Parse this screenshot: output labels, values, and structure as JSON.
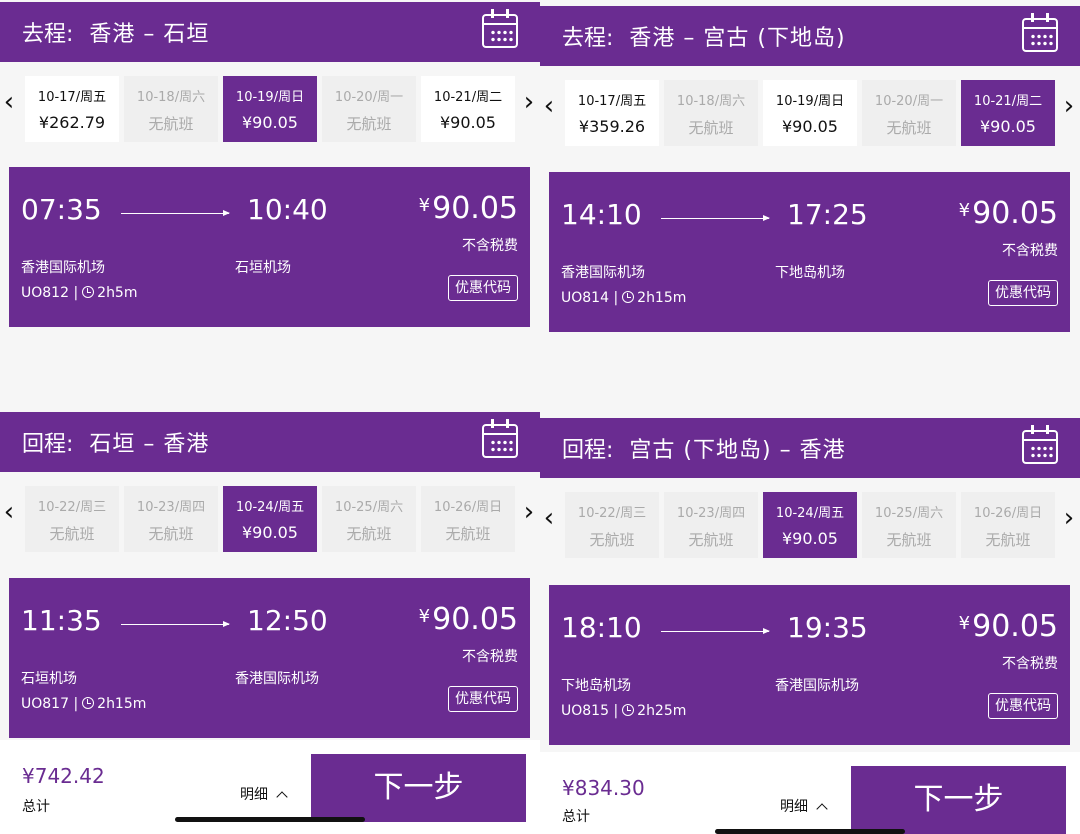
{
  "panels": [
    {
      "segments": [
        {
          "label": "去程:",
          "route": "香港 – 石垣",
          "dates": [
            {
              "date": "10-17/周五",
              "price": "¥262.79",
              "state": "avail"
            },
            {
              "date": "10-18/周六",
              "price": "无航班",
              "state": "none"
            },
            {
              "date": "10-19/周日",
              "price": "¥90.05",
              "state": "sel"
            },
            {
              "date": "10-20/周一",
              "price": "无航班",
              "state": "none"
            },
            {
              "date": "10-21/周二",
              "price": "¥90.05",
              "state": "avail"
            }
          ],
          "flight": {
            "dep_time": "07:35",
            "arr_time": "10:40",
            "price": "90.05",
            "tax": "不含税费",
            "dep_airport": "香港国际机场",
            "arr_airport": "石垣机场",
            "flight_no": "UO812 |",
            "duration": "2h5m",
            "promo": "优惠代码"
          }
        },
        {
          "label": "回程:",
          "route": "石垣 – 香港",
          "dates": [
            {
              "date": "10-22/周三",
              "price": "无航班",
              "state": "none"
            },
            {
              "date": "10-23/周四",
              "price": "无航班",
              "state": "none"
            },
            {
              "date": "10-24/周五",
              "price": "¥90.05",
              "state": "sel"
            },
            {
              "date": "10-25/周六",
              "price": "无航班",
              "state": "none"
            },
            {
              "date": "10-26/周日",
              "price": "无航班",
              "state": "none"
            }
          ],
          "flight": {
            "dep_time": "11:35",
            "arr_time": "12:50",
            "price": "90.05",
            "tax": "不含税费",
            "dep_airport": "石垣机场",
            "arr_airport": "香港国际机场",
            "flight_no": "UO817 |",
            "duration": "2h15m",
            "promo": "优惠代码"
          }
        }
      ],
      "footer": {
        "total": "¥742.42",
        "total_label": "总计",
        "detail": "明细",
        "next": "下一步"
      }
    },
    {
      "segments": [
        {
          "label": "去程:",
          "route": "香港 – 宫古 (下地岛)",
          "dates": [
            {
              "date": "10-17/周五",
              "price": "¥359.26",
              "state": "avail"
            },
            {
              "date": "10-18/周六",
              "price": "无航班",
              "state": "none"
            },
            {
              "date": "10-19/周日",
              "price": "¥90.05",
              "state": "avail"
            },
            {
              "date": "10-20/周一",
              "price": "无航班",
              "state": "none"
            },
            {
              "date": "10-21/周二",
              "price": "¥90.05",
              "state": "sel"
            }
          ],
          "flight": {
            "dep_time": "14:10",
            "arr_time": "17:25",
            "price": "90.05",
            "tax": "不含税费",
            "dep_airport": "香港国际机场",
            "arr_airport": "下地岛机场",
            "flight_no": "UO814 |",
            "duration": "2h15m",
            "promo": "优惠代码"
          }
        },
        {
          "label": "回程:",
          "route": "宫古 (下地岛) – 香港",
          "dates": [
            {
              "date": "10-22/周三",
              "price": "无航班",
              "state": "none"
            },
            {
              "date": "10-23/周四",
              "price": "无航班",
              "state": "none"
            },
            {
              "date": "10-24/周五",
              "price": "¥90.05",
              "state": "sel"
            },
            {
              "date": "10-25/周六",
              "price": "无航班",
              "state": "none"
            },
            {
              "date": "10-26/周日",
              "price": "无航班",
              "state": "none"
            }
          ],
          "flight": {
            "dep_time": "18:10",
            "arr_time": "19:35",
            "price": "90.05",
            "tax": "不含税费",
            "dep_airport": "下地岛机场",
            "arr_airport": "香港国际机场",
            "flight_no": "UO815 |",
            "duration": "2h25m",
            "promo": "优惠代码"
          }
        }
      ],
      "footer": {
        "total": "¥834.30",
        "total_label": "总计",
        "detail": "明细",
        "next": "下一步"
      }
    }
  ],
  "icons": {
    "calendar": "calendar-icon",
    "chevron_left": "chevron-left-icon",
    "chevron_right": "chevron-right-icon",
    "clock": "clock-icon",
    "caret_up": "chevron-up-icon"
  },
  "colors": {
    "brand": "#6a2c91",
    "background": "#f6f6f6",
    "unavailable_tab": "#efefef"
  }
}
